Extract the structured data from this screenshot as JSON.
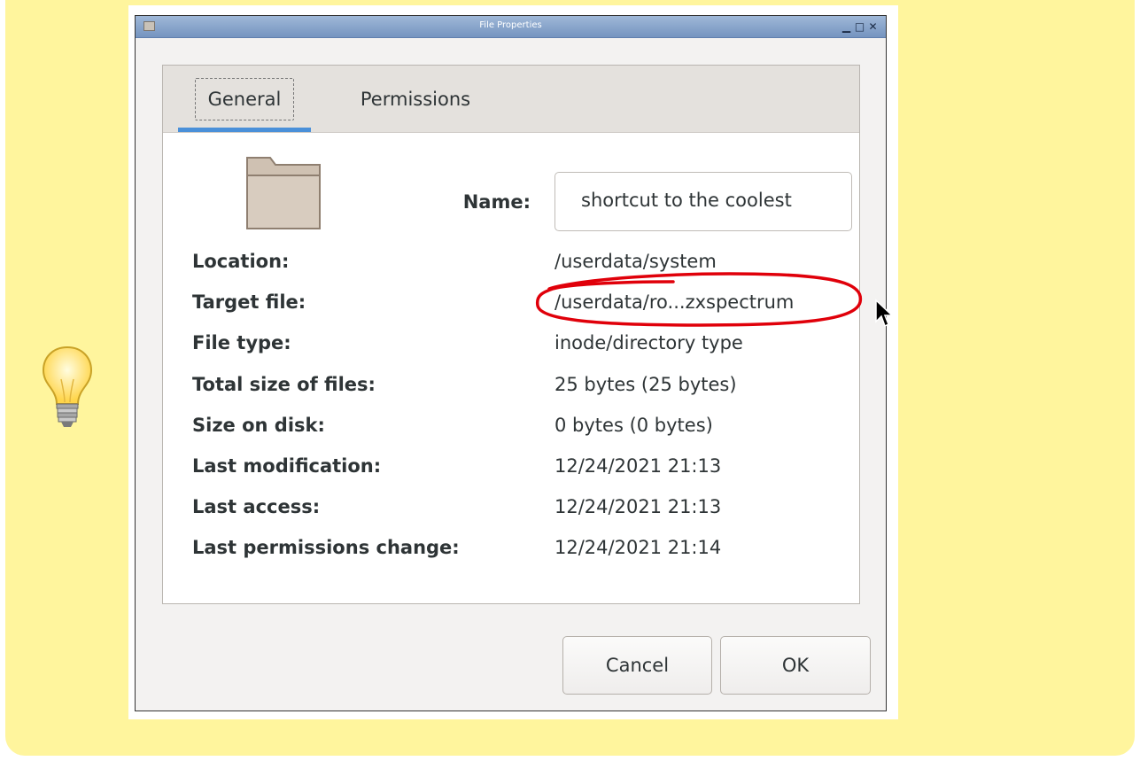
{
  "window": {
    "title": "File Properties",
    "controls": [
      "▁",
      "□",
      "✕"
    ]
  },
  "tabs": [
    {
      "label": "General",
      "active": true
    },
    {
      "label": "Permissions",
      "active": false
    }
  ],
  "general": {
    "name_label": "Name:",
    "name_value": "shortcut to the coolest",
    "rows": [
      {
        "key": "Location:",
        "value": "/userdata/system"
      },
      {
        "key": "Target file:",
        "value": "/userdata/ro...zxspectrum"
      },
      {
        "key": "File type:",
        "value": "inode/directory type"
      },
      {
        "key": "Total size of files:",
        "value": "25 bytes (25 bytes)"
      },
      {
        "key": "Size on disk:",
        "value": "0 bytes (0 bytes)"
      },
      {
        "key": "Last modification:",
        "value": "12/24/2021 21:13"
      },
      {
        "key": "Last access:",
        "value": "12/24/2021 21:13"
      },
      {
        "key": "Last permissions change:",
        "value": "12/24/2021 21:14"
      }
    ]
  },
  "buttons": {
    "cancel": "Cancel",
    "ok": "OK"
  },
  "icons": {
    "note": "lightbulb-icon",
    "file": "folder-icon"
  },
  "colors": {
    "note_background": "#fff59d",
    "tab_accent": "#4a90d9",
    "annotation": "#e0000a"
  }
}
